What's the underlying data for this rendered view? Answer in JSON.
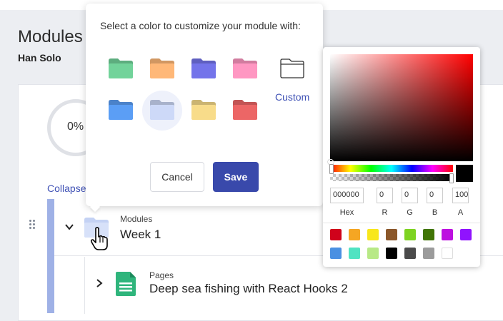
{
  "header": {
    "title": "Modules",
    "user": "Han Solo"
  },
  "progress": {
    "label": "0%"
  },
  "collapse_label": "Collapse",
  "module": {
    "type_label": "Modules",
    "title": "Week 1"
  },
  "page_item": {
    "type_label": "Pages",
    "title": "Deep sea fishing with React Hooks 2"
  },
  "color_chooser": {
    "prompt": "Select a color to customize your module with:",
    "folder_colors": [
      "#72d39a",
      "#ffb878",
      "#7474ea",
      "#ff97c2",
      "#5b9ef5",
      "#cdd9f8",
      "#f8dc8a",
      "#ec6666"
    ],
    "selected_index": 5,
    "custom_label": "Custom",
    "cancel_label": "Cancel",
    "save_label": "Save",
    "accent": "#3949ab"
  },
  "picker": {
    "hex": "000000",
    "r": "0",
    "g": "0",
    "b": "0",
    "a": "100",
    "labels": {
      "hex": "Hex",
      "r": "R",
      "g": "G",
      "b": "B",
      "a": "A"
    },
    "swatches": [
      "#d0021b",
      "#f5a623",
      "#f8e71c",
      "#8b572a",
      "#7ed321",
      "#417505",
      "#bd10e0",
      "#9013fe",
      "#4a90e2",
      "#50e3c2",
      "#b8e986",
      "#000000",
      "#4a4a4a",
      "#9b9b9b",
      "#ffffff"
    ]
  }
}
